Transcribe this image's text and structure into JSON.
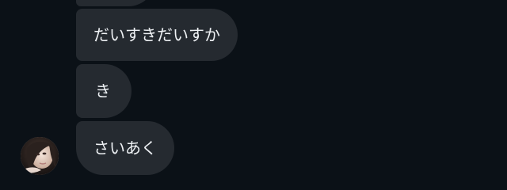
{
  "conversation": {
    "messages": [
      {
        "text": "だいすきだいすか"
      },
      {
        "text": "き"
      },
      {
        "text": "さいあく"
      }
    ],
    "bubble_color": "#252a30",
    "background_color": "#0b1117",
    "text_color": "#eef1f4"
  },
  "sender": {
    "avatar_icon": "profile-photo-avatar"
  }
}
